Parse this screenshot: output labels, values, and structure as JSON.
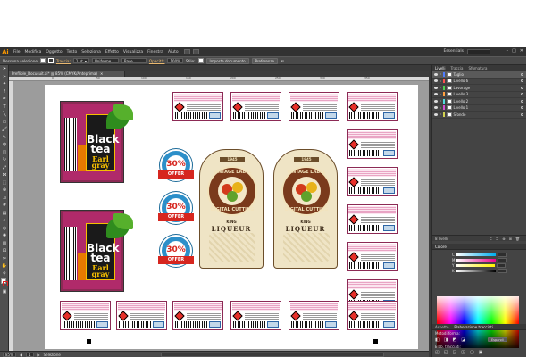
{
  "app": {
    "logo": "Ai"
  },
  "menu": [
    "File",
    "Modifica",
    "Oggetto",
    "Testo",
    "Seleziona",
    "Effetto",
    "Visualizza",
    "Finestra",
    "Aiuto"
  ],
  "workspace": "Essentials",
  "control": {
    "selection": "Nessuna selezione",
    "stroke_label": "Traccia:",
    "stroke_value": "1 pt",
    "profile": "Uniforme",
    "brush": "Base",
    "opacity_label": "Opacità:",
    "opacity_value": "100%",
    "style_label": "Stile:",
    "doc_setup": "Imposta documento",
    "preferences": "Preferenze"
  },
  "document": {
    "tab": "Prefliple_Docusuit.ai* @ 85% (CMYK/Anteprima)"
  },
  "ruler_ticks": [
    "0",
    "50",
    "100",
    "150",
    "200",
    "250",
    "300",
    "350"
  ],
  "status": {
    "zoom": "85%",
    "page": "1",
    "tool": "Selezione"
  },
  "panels": {
    "tabs": [
      "Livelli",
      "Traccia",
      "Sfumatura"
    ],
    "layers": [
      {
        "name": "Taglio",
        "color": "#4f7cff"
      },
      {
        "name": "Livello 6",
        "color": "#ff4f4f"
      },
      {
        "name": "Lavorage",
        "color": "#4fd14f"
      },
      {
        "name": "Livello 3",
        "color": "#ff9f3f"
      },
      {
        "name": "Livello 2",
        "color": "#4fdcdc"
      },
      {
        "name": "Livello 1",
        "color": "#d14fd1"
      },
      {
        "name": "Sfondo",
        "color": "#d1d14f"
      }
    ],
    "layers_count": "8 livelli",
    "color_tabs": [
      "Colore"
    ],
    "channels": [
      "C",
      "M",
      "Y",
      "K"
    ],
    "bottom_tabs": [
      "Aspetto",
      "Elaborazione tracciati"
    ],
    "pathfinder_labels": [
      "Metodi forma:",
      "Elab. tracciati:"
    ],
    "expand": "Espandi"
  },
  "artboard": {
    "tea": {
      "title": "Black tea",
      "sub": "Earl gray"
    },
    "badge": {
      "num": "30%",
      "ribbon": "OFFER"
    },
    "vintage": {
      "top": "1945",
      "ring": "VINTAGE LABEL",
      "ring2": "DIGITAL CUTTING",
      "king": "KING",
      "liq": "LIQUEUR"
    }
  }
}
